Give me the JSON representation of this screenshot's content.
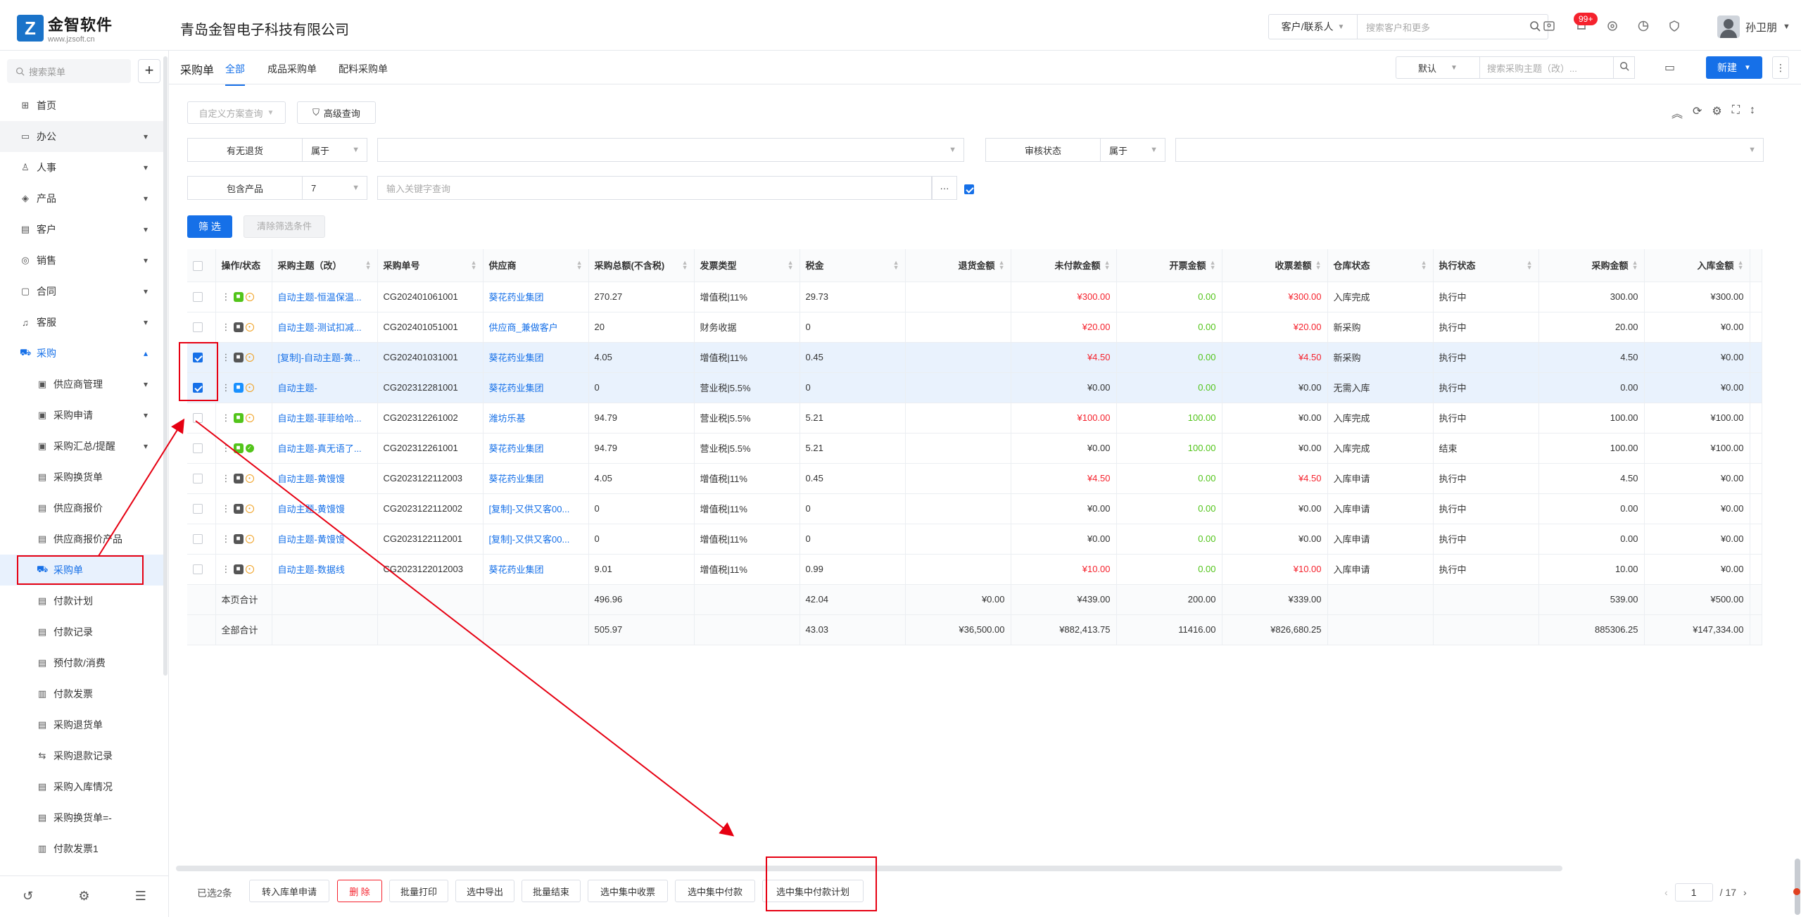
{
  "brand": {
    "name": "金智软件",
    "url": "www.jzsoft.cn"
  },
  "company": "青岛金智电子科技有限公司",
  "top_search": {
    "scope": "客户/联系人",
    "placeholder": "搜索客户和更多"
  },
  "notifications": {
    "badge": "99+"
  },
  "user": {
    "name": "孙卫朋"
  },
  "sidebar": {
    "search_placeholder": "搜索菜单",
    "items": [
      {
        "label": "首页",
        "icon": "grid-icon"
      },
      {
        "label": "办公",
        "icon": "monitor-icon"
      },
      {
        "label": "人事",
        "icon": "people-icon"
      },
      {
        "label": "产品",
        "icon": "box-icon"
      },
      {
        "label": "客户",
        "icon": "contact-icon"
      },
      {
        "label": "销售",
        "icon": "sales-icon"
      },
      {
        "label": "合同",
        "icon": "contract-icon"
      },
      {
        "label": "客服",
        "icon": "headset-icon"
      },
      {
        "label": "采购",
        "icon": "cart-icon"
      }
    ],
    "purchase_sub": [
      "供应商管理",
      "采购申请",
      "采购汇总/提醒",
      "采购换货单",
      "供应商报价",
      "供应商报价产品",
      "采购单",
      "付款计划",
      "付款记录",
      "预付款/消费",
      "付款发票",
      "采购退货单",
      "采购退款记录",
      "采购入库情况",
      "采购换货单=-",
      "付款发票1"
    ]
  },
  "subhead": {
    "title": "采购单",
    "tabs": [
      "全部",
      "成品采购单",
      "配料采购单"
    ],
    "view": "默认",
    "search_placeholder": "搜索采购主题（改）...",
    "new_label": "新建"
  },
  "toolbar": {
    "custom_query": "自定义方案查询",
    "advanced": "高级查询"
  },
  "filters": {
    "return_label": "有无退货",
    "return_op": "属于",
    "audit_label": "审核状态",
    "audit_op": "属于",
    "product_label": "包含产品",
    "product_op": "7",
    "product_placeholder": "输入关键字查询",
    "filter_btn": "筛 选",
    "clear_btn": "清除筛选条件"
  },
  "table": {
    "headers": [
      "操作/状态",
      "采购主题（改）",
      "采购单号",
      "供应商",
      "采购总额(不含税)",
      "发票类型",
      "税金",
      "退货金额",
      "未付款金额",
      "开票金额",
      "收票差额",
      "仓库状态",
      "执行状态",
      "采购金额",
      "入库金额"
    ],
    "rows": [
      {
        "subject": "自动主题-恒温保温...",
        "no": "CG202401061001",
        "supplier": "葵花药业集团",
        "total": "270.27",
        "invoice": "增值税|11%",
        "tax": "29.73",
        "ret": "",
        "unpaid": "¥300.00",
        "billed": "0.00",
        "diff": "¥300.00",
        "wh": "入库完成",
        "exec": "执行中",
        "amount": "300.00",
        "stock": "¥300.00",
        "sel": false,
        "st": "ring"
      },
      {
        "subject": "自动主题-测试扣减...",
        "no": "CG202401051001",
        "supplier": "供应商_兼做客户",
        "total": "20",
        "invoice": "财务收据",
        "tax": "0",
        "ret": "",
        "unpaid": "¥20.00",
        "billed": "0.00",
        "diff": "¥20.00",
        "wh": "新采购",
        "exec": "执行中",
        "amount": "20.00",
        "stock": "¥0.00",
        "sel": false,
        "st": "ring"
      },
      {
        "subject": "[复制]-自动主题-黄...",
        "no": "CG202401031001",
        "supplier": "葵花药业集团",
        "total": "4.05",
        "invoice": "增值税|11%",
        "tax": "0.45",
        "ret": "",
        "unpaid": "¥4.50",
        "billed": "0.00",
        "diff": "¥4.50",
        "wh": "新采购",
        "exec": "执行中",
        "amount": "4.50",
        "stock": "¥0.00",
        "sel": true,
        "st": "ring"
      },
      {
        "subject": "自动主题-",
        "no": "CG202312281001",
        "supplier": "葵花药业集团",
        "total": "0",
        "invoice": "营业税|5.5%",
        "tax": "0",
        "ret": "",
        "unpaid": "¥0.00",
        "billed": "0.00",
        "diff": "¥0.00",
        "wh": "无需入库",
        "exec": "执行中",
        "amount": "0.00",
        "stock": "¥0.00",
        "sel": true,
        "st": "ring"
      },
      {
        "subject": "自动主题-菲菲给哈...",
        "no": "CG202312261002",
        "supplier": "潍坊乐基",
        "total": "94.79",
        "invoice": "营业税|5.5%",
        "tax": "5.21",
        "ret": "",
        "unpaid": "¥100.00",
        "billed": "100.00",
        "diff": "¥0.00",
        "wh": "入库完成",
        "exec": "执行中",
        "amount": "100.00",
        "stock": "¥100.00",
        "sel": false,
        "st": "ring"
      },
      {
        "subject": "自动主题-真无语了...",
        "no": "CG202312261001",
        "supplier": "葵花药业集团",
        "total": "94.79",
        "invoice": "营业税|5.5%",
        "tax": "5.21",
        "ret": "",
        "unpaid": "¥0.00",
        "billed": "100.00",
        "diff": "¥0.00",
        "wh": "入库完成",
        "exec": "结束",
        "amount": "100.00",
        "stock": "¥100.00",
        "sel": false,
        "st": "ok"
      },
      {
        "subject": "自动主题-黄馒馒",
        "no": "CG2023122112003",
        "supplier": "葵花药业集团",
        "total": "4.05",
        "invoice": "增值税|11%",
        "tax": "0.45",
        "ret": "",
        "unpaid": "¥4.50",
        "billed": "0.00",
        "diff": "¥4.50",
        "wh": "入库申请",
        "exec": "执行中",
        "amount": "4.50",
        "stock": "¥0.00",
        "sel": false,
        "st": "ring"
      },
      {
        "subject": "自动主题-黄馒馒",
        "no": "CG2023122112002",
        "supplier": "[复制]-又供又客00...",
        "total": "0",
        "invoice": "增值税|11%",
        "tax": "0",
        "ret": "",
        "unpaid": "¥0.00",
        "billed": "0.00",
        "diff": "¥0.00",
        "wh": "入库申请",
        "exec": "执行中",
        "amount": "0.00",
        "stock": "¥0.00",
        "sel": false,
        "st": "ring"
      },
      {
        "subject": "自动主题-黄馒馒",
        "no": "CG2023122112001",
        "supplier": "[复制]-又供又客00...",
        "total": "0",
        "invoice": "增值税|11%",
        "tax": "0",
        "ret": "",
        "unpaid": "¥0.00",
        "billed": "0.00",
        "diff": "¥0.00",
        "wh": "入库申请",
        "exec": "执行中",
        "amount": "0.00",
        "stock": "¥0.00",
        "sel": false,
        "st": "ring"
      },
      {
        "subject": "自动主题-数据线",
        "no": "CG2023122012003",
        "supplier": "葵花药业集团",
        "total": "9.01",
        "invoice": "增值税|11%",
        "tax": "0.99",
        "ret": "",
        "unpaid": "¥10.00",
        "billed": "0.00",
        "diff": "¥10.00",
        "wh": "入库申请",
        "exec": "执行中",
        "amount": "10.00",
        "stock": "¥0.00",
        "sel": false,
        "st": "ring"
      }
    ],
    "page_sum": {
      "label": "本页合计",
      "total": "496.96",
      "tax": "42.04",
      "ret": "¥0.00",
      "unpaid": "¥439.00",
      "billed": "200.00",
      "diff": "¥339.00",
      "amount": "539.00",
      "stock": "¥500.00"
    },
    "all_sum": {
      "label": "全部合计",
      "total": "505.97",
      "tax": "43.03",
      "ret": "¥36,500.00",
      "unpaid": "¥882,413.75",
      "billed": "11416.00",
      "diff": "¥826,680.25",
      "amount": "885306.25",
      "stock": "¥147,334.00"
    }
  },
  "bottom": {
    "selected": "已选2条",
    "buttons": [
      "转入库单申请",
      "删 除",
      "批量打印",
      "选中导出",
      "批量结束",
      "选中集中收票",
      "选中集中付款",
      "选中集中付款计划"
    ],
    "page": "1",
    "total_pages": "/ 17"
  },
  "colors": {
    "accent": "#1670e8",
    "danger": "#f5222d",
    "success": "#52c41a",
    "annotation": "#e60012"
  }
}
